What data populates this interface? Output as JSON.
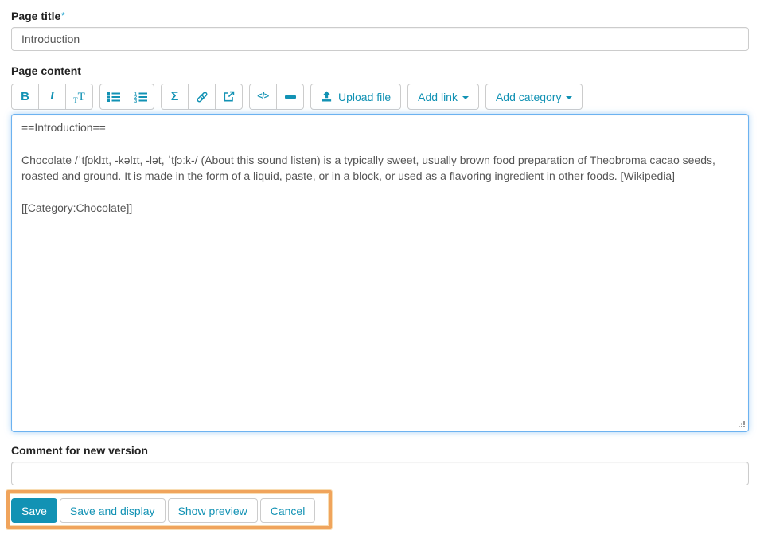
{
  "colors": {
    "accent_teal": "#1292b4",
    "focus_border": "#6cb2f0",
    "highlight_orange": "#f0a45c",
    "required_marker": "#3fb0d5"
  },
  "page_title": {
    "label": "Page title",
    "required_marker": "*",
    "value": "Introduction"
  },
  "editor": {
    "label": "Page content",
    "content": "==Introduction==\n\nChocolate /ˈtʃɒklɪt, -kəlɪt, -lət, ˈtʃɔːk-/ (About this sound listen) is a typically sweet, usually brown food preparation of Theobroma cacao seeds, roasted and ground. It is made in the form of a liquid, paste, or in a block, or used as a flavoring ingredient in other foods. [Wikipedia]\n\n[[Category:Chocolate]]",
    "toolbar": {
      "bold": "B",
      "italic": "I",
      "heading_small": "T",
      "heading_big": "T",
      "formula": "Σ",
      "code": "</>",
      "upload": "Upload file",
      "add_link": "Add link",
      "add_category": "Add category"
    }
  },
  "comment": {
    "label": "Comment for new version",
    "value": ""
  },
  "actions": {
    "save": "Save",
    "save_and_display": "Save and display",
    "show_preview": "Show preview",
    "cancel": "Cancel"
  }
}
